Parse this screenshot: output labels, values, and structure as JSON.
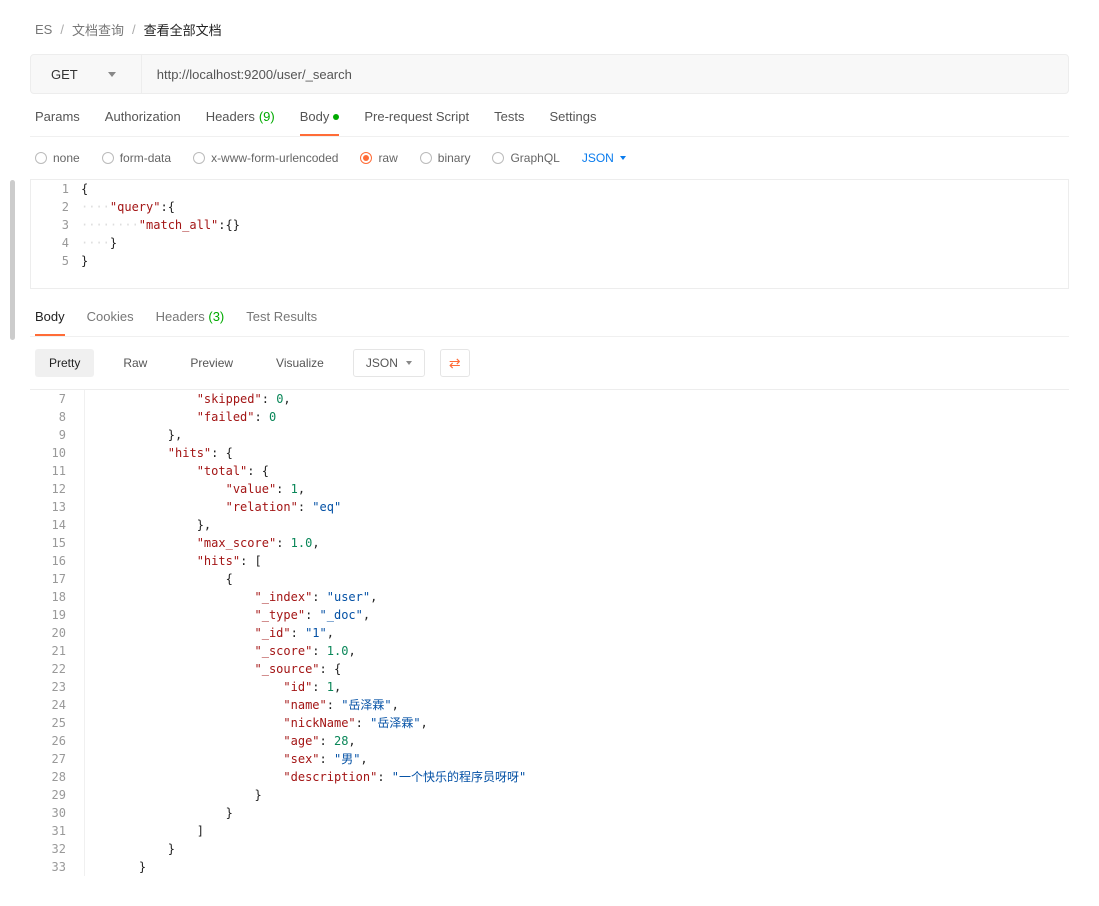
{
  "breadcrumb": {
    "items": [
      "ES",
      "文档查询",
      "查看全部文档"
    ]
  },
  "request": {
    "method": "GET",
    "url": "http://localhost:9200/user/_search",
    "tabs": {
      "params": "Params",
      "auth": "Authorization",
      "headers": "Headers",
      "headers_count": "(9)",
      "body": "Body",
      "prereq": "Pre-request Script",
      "tests": "Tests",
      "settings": "Settings"
    },
    "body_opts": {
      "none": "none",
      "form_data": "form-data",
      "urlencoded": "x-www-form-urlencoded",
      "raw": "raw",
      "binary": "binary",
      "graphql": "GraphQL",
      "type": "JSON"
    },
    "body_editor": {
      "lines": [
        1,
        2,
        3,
        4,
        5
      ],
      "l1": "{",
      "l2_key": "\"query\"",
      "l2_after": ":{",
      "l3_key": "\"match_all\"",
      "l3_after": ":{}",
      "l4": "}",
      "l5": "}"
    }
  },
  "response": {
    "tabs": {
      "body": "Body",
      "cookies": "Cookies",
      "headers": "Headers",
      "headers_count": "(3)",
      "tests": "Test Results"
    },
    "views": {
      "pretty": "Pretty",
      "raw": "Raw",
      "preview": "Preview",
      "visualize": "Visualize",
      "type": "JSON"
    },
    "lines": [
      {
        "n": 7,
        "indent": 3,
        "key": "\"skipped\"",
        "sep": ": ",
        "val": "0",
        "vt": "num",
        "tail": ","
      },
      {
        "n": 8,
        "indent": 3,
        "key": "\"failed\"",
        "sep": ": ",
        "val": "0",
        "vt": "num",
        "tail": ""
      },
      {
        "n": 9,
        "indent": 2,
        "plain": "},"
      },
      {
        "n": 10,
        "indent": 2,
        "key": "\"hits\"",
        "sep": ": ",
        "plain_after": "{"
      },
      {
        "n": 11,
        "indent": 3,
        "key": "\"total\"",
        "sep": ": ",
        "plain_after": "{"
      },
      {
        "n": 12,
        "indent": 4,
        "key": "\"value\"",
        "sep": ": ",
        "val": "1",
        "vt": "num",
        "tail": ","
      },
      {
        "n": 13,
        "indent": 4,
        "key": "\"relation\"",
        "sep": ": ",
        "val": "\"eq\"",
        "vt": "str",
        "tail": ""
      },
      {
        "n": 14,
        "indent": 3,
        "plain": "},"
      },
      {
        "n": 15,
        "indent": 3,
        "key": "\"max_score\"",
        "sep": ": ",
        "val": "1.0",
        "vt": "num",
        "tail": ","
      },
      {
        "n": 16,
        "indent": 3,
        "key": "\"hits\"",
        "sep": ": ",
        "plain_after": "["
      },
      {
        "n": 17,
        "indent": 4,
        "plain": "{"
      },
      {
        "n": 18,
        "indent": 5,
        "key": "\"_index\"",
        "sep": ": ",
        "val": "\"user\"",
        "vt": "str",
        "tail": ","
      },
      {
        "n": 19,
        "indent": 5,
        "key": "\"_type\"",
        "sep": ": ",
        "val": "\"_doc\"",
        "vt": "str",
        "tail": ","
      },
      {
        "n": 20,
        "indent": 5,
        "key": "\"_id\"",
        "sep": ": ",
        "val": "\"1\"",
        "vt": "str",
        "tail": ","
      },
      {
        "n": 21,
        "indent": 5,
        "key": "\"_score\"",
        "sep": ": ",
        "val": "1.0",
        "vt": "num",
        "tail": ","
      },
      {
        "n": 22,
        "indent": 5,
        "key": "\"_source\"",
        "sep": ": ",
        "plain_after": "{"
      },
      {
        "n": 23,
        "indent": 6,
        "key": "\"id\"",
        "sep": ": ",
        "val": "1",
        "vt": "num",
        "tail": ","
      },
      {
        "n": 24,
        "indent": 6,
        "key": "\"name\"",
        "sep": ": ",
        "val": "\"岳泽霖\"",
        "vt": "cjk",
        "tail": ","
      },
      {
        "n": 25,
        "indent": 6,
        "key": "\"nickName\"",
        "sep": ": ",
        "val": "\"岳泽霖\"",
        "vt": "cjk",
        "tail": ","
      },
      {
        "n": 26,
        "indent": 6,
        "key": "\"age\"",
        "sep": ": ",
        "val": "28",
        "vt": "num",
        "tail": ","
      },
      {
        "n": 27,
        "indent": 6,
        "key": "\"sex\"",
        "sep": ": ",
        "val": "\"男\"",
        "vt": "cjk",
        "tail": ","
      },
      {
        "n": 28,
        "indent": 6,
        "key": "\"description\"",
        "sep": ": ",
        "val": "\"一个快乐的程序员呀呀\"",
        "vt": "cjk",
        "tail": ""
      },
      {
        "n": 29,
        "indent": 5,
        "plain": "}"
      },
      {
        "n": 30,
        "indent": 4,
        "plain": "}"
      },
      {
        "n": 31,
        "indent": 3,
        "plain": "]"
      },
      {
        "n": 32,
        "indent": 2,
        "plain": "}"
      },
      {
        "n": 33,
        "indent": 1,
        "plain": "}"
      }
    ]
  }
}
